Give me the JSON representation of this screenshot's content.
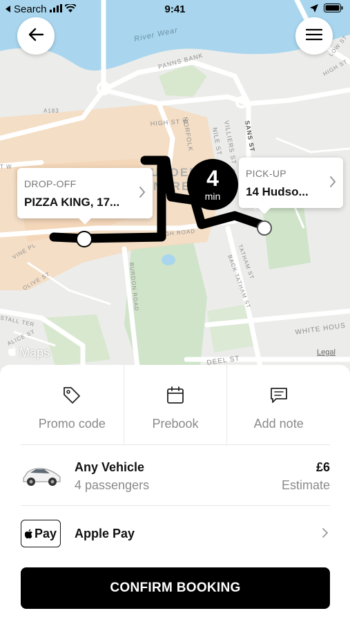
{
  "status_bar": {
    "back_app": "Search",
    "time": "9:41"
  },
  "map": {
    "street_labels": [
      "River Wear",
      "PANNS BANK",
      "A183",
      "HIGH ST W",
      "NORFOLK",
      "NILE ST",
      "VILLIERS ST",
      "SANS ST",
      "BOROUGH ROAD",
      "BURDON ROAD",
      "TATHAM ST",
      "BACK TATHAM ST",
      "VINE PL",
      "OLIVE ST",
      "STALL TER",
      "ALICE ST",
      "WHITE HOUS",
      "DEEL ST",
      "LOW ST",
      "HIGH ST",
      "T W"
    ],
    "area_label": [
      "UNDERLAND",
      "NTRE"
    ],
    "maps_label": "Maps",
    "legal_label": "Legal",
    "dropoff": {
      "label": "DROP-OFF",
      "value": "PIZZA KING, 17..."
    },
    "pickup": {
      "label": "PICK-UP",
      "value": "14 Hudso..."
    },
    "eta": {
      "value": "4",
      "unit": "min"
    },
    "route_color": "#000000"
  },
  "options": [
    {
      "label": "Promo code",
      "icon": "tag-icon"
    },
    {
      "label": "Prebook",
      "icon": "calendar-icon"
    },
    {
      "label": "Add note",
      "icon": "note-icon"
    }
  ],
  "vehicle": {
    "name": "Any Vehicle",
    "passengers": "4 passengers",
    "price": "£6",
    "price_note": "Estimate",
    "icon": "car-icon"
  },
  "payment": {
    "badge": "Pay",
    "name": "Apple Pay",
    "icon": "apple-pay-icon"
  },
  "confirm_label": "CONFIRM BOOKING",
  "colors": {
    "water": "#a9d6ee",
    "park": "#cfe4c9",
    "urban": "#f6dcc0",
    "primary": "#000000"
  }
}
